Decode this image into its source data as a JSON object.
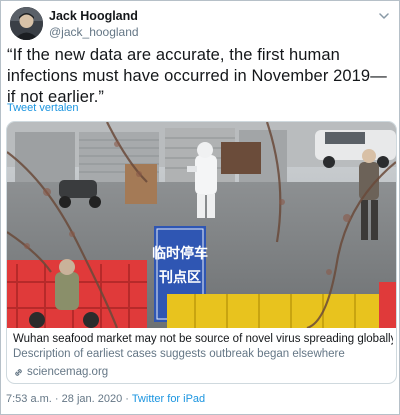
{
  "author": {
    "name": "Jack Hoogland",
    "handle": "@jack_hoogland"
  },
  "tweet": {
    "text": "“If the new data are accurate, the first human infections must have occurred in November 2019—if not earlier.”",
    "translate_label": "Tweet vertalen"
  },
  "card": {
    "image_icon": "photo-wuhan-market",
    "sign_text_line1": "临时停车",
    "sign_text_line2": "刊点区",
    "title": "Wuhan seafood market may not be source of novel virus spreading globally",
    "description": "Description of earliest cases suggests outbreak began elsewhere",
    "domain": "sciencemag.org"
  },
  "footer": {
    "time": "7:53 a.m.",
    "separator1": "·",
    "date": "28 jan. 2020",
    "separator2": "·",
    "source": "Twitter for iPad"
  },
  "colors": {
    "link": "#1b95e0",
    "secondary_text": "#657786",
    "border": "#cfd9de",
    "barrier_red": "#e03a3a",
    "barrier_yellow": "#e8c31e"
  }
}
